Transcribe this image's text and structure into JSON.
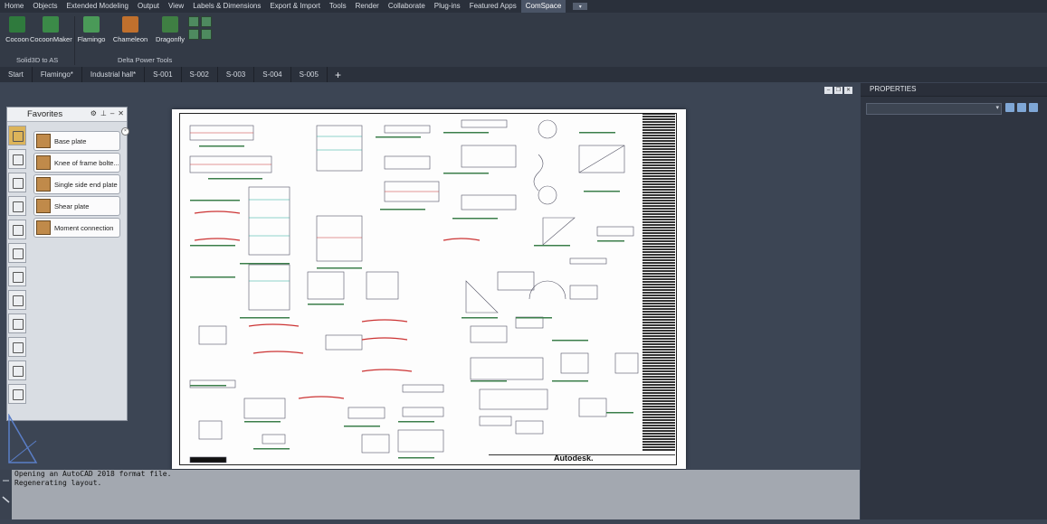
{
  "menu": {
    "items": [
      "Home",
      "Objects",
      "Extended Modeling",
      "Output",
      "View",
      "Labels & Dimensions",
      "Export & Import",
      "Tools",
      "Render",
      "Collaborate",
      "Plug-ins",
      "Featured Apps",
      "ComSpace"
    ],
    "active": "ComSpace"
  },
  "ribbon": {
    "buttons": [
      {
        "label": "Cocoon",
        "icon": "cocoon-icon",
        "color": "#2f7a3d"
      },
      {
        "label": "CocoonMaker",
        "icon": "cocoonmaker-icon",
        "color": "#3b8a48"
      },
      {
        "label": "Flamingo",
        "icon": "flamingo-icon",
        "color": "#4a9a58"
      },
      {
        "label": "Chameleon",
        "icon": "chameleon-icon",
        "color": "#c0702d"
      },
      {
        "label": "Dragonfly",
        "icon": "dragonfly-icon",
        "color": "#3f7f43"
      }
    ],
    "groups": [
      "Solid3D to AS",
      "Delta Power Tools"
    ]
  },
  "file_tabs": [
    "Start",
    "Flamingo*",
    "Industrial hall*",
    "S-001",
    "S-002",
    "S-003",
    "S-004",
    "S-005"
  ],
  "favorites": {
    "title": "Favorites",
    "items": [
      "Base plate",
      "Knee of frame bolte...",
      "Single side end plate",
      "Shear plate",
      "Moment connection"
    ]
  },
  "properties": {
    "title": "PROPERTIES"
  },
  "sheet": {
    "logo_text": "Autodesk."
  },
  "command_line": {
    "lines": [
      "Opening an AutoCAD 2018 format file.",
      "Regenerating layout."
    ]
  }
}
